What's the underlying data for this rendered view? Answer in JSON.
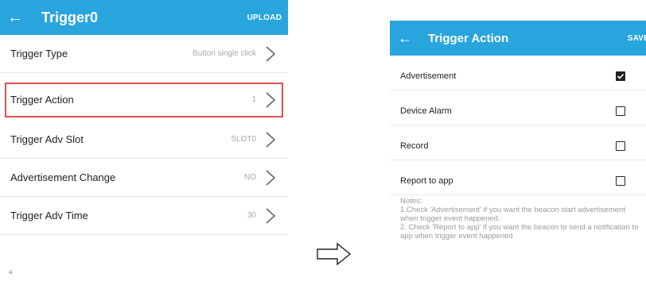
{
  "left": {
    "header": {
      "back_glyph": "←",
      "title": "Trigger0",
      "action": "UPLOAD"
    },
    "rows": [
      {
        "label": "Trigger Type",
        "value": "Button single click"
      },
      {
        "label": "Trigger Action",
        "value": "1"
      },
      {
        "label": "Trigger Adv Slot",
        "value": "SLOT0"
      },
      {
        "label": "Advertisement Change",
        "value": "NO"
      },
      {
        "label": "Trigger Adv Time",
        "value": "30"
      }
    ],
    "bottom_glyph": "+"
  },
  "right": {
    "header": {
      "back_glyph": "←",
      "title": "Trigger Action",
      "action": "SAVE"
    },
    "options": [
      {
        "label": "Advertisement",
        "checked": true
      },
      {
        "label": "Device Alarm",
        "checked": false
      },
      {
        "label": "Record",
        "checked": false
      },
      {
        "label": "Report to app",
        "checked": false
      }
    ],
    "notes": {
      "heading": "Notes:",
      "line1": "1.Check 'Advertisement' if you want the beacon start advertisement when trigger event happened.",
      "line2": "2. Check 'Report to app' if you want the beacon to send a notification to app when trigger event happened"
    }
  },
  "colors": {
    "appbar": "#29a5de",
    "highlight": "#d9534f"
  },
  "icons": {
    "back": "arrow-left-icon",
    "chevron": "chevron-right-icon",
    "flow_arrow": "outline-arrow-right-icon"
  }
}
